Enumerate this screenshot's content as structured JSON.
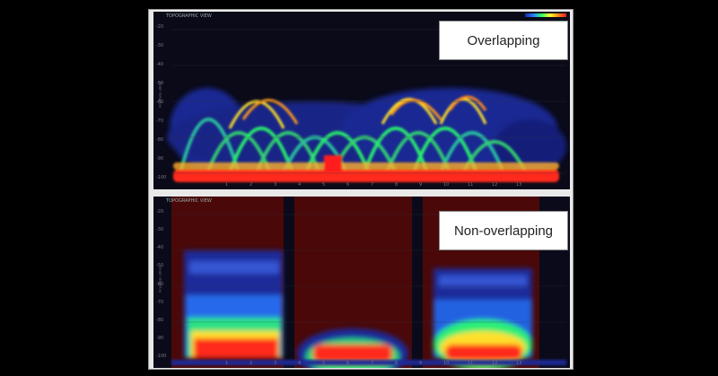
{
  "panels": {
    "top": {
      "label": "Overlapping",
      "app_tag": "TOPOGRAPHIC VIEW",
      "y_axis_label": "Amplitude (dBm)",
      "y_ticks": [
        "-20",
        "-30",
        "-40",
        "-50",
        "-60",
        "-70",
        "-80",
        "-90",
        "-100"
      ],
      "x_ticks": [
        "1",
        "2",
        "3",
        "4",
        "5",
        "6",
        "7",
        "8",
        "9",
        "10",
        "11",
        "12",
        "13"
      ]
    },
    "bottom": {
      "label": "Non-overlapping",
      "app_tag": "TOPOGRAPHIC VIEW",
      "y_axis_label": "Amplitude (dBm)",
      "y_ticks": [
        "-20",
        "-30",
        "-40",
        "-50",
        "-60",
        "-70",
        "-80",
        "-90",
        "-100"
      ],
      "x_ticks": [
        "1",
        "2",
        "3",
        "4",
        "5",
        "6",
        "7",
        "8",
        "9",
        "10",
        "11",
        "12",
        "13"
      ]
    }
  },
  "colors": {
    "background": "#000000",
    "frame": "#e9e9e9",
    "plot_bg": "#0a0a18",
    "heat_low": "#1a2a9a",
    "heat_mid": "#2aff6a",
    "heat_high": "#ff1a1a",
    "nonoverlap_tint": "#4a0808"
  }
}
